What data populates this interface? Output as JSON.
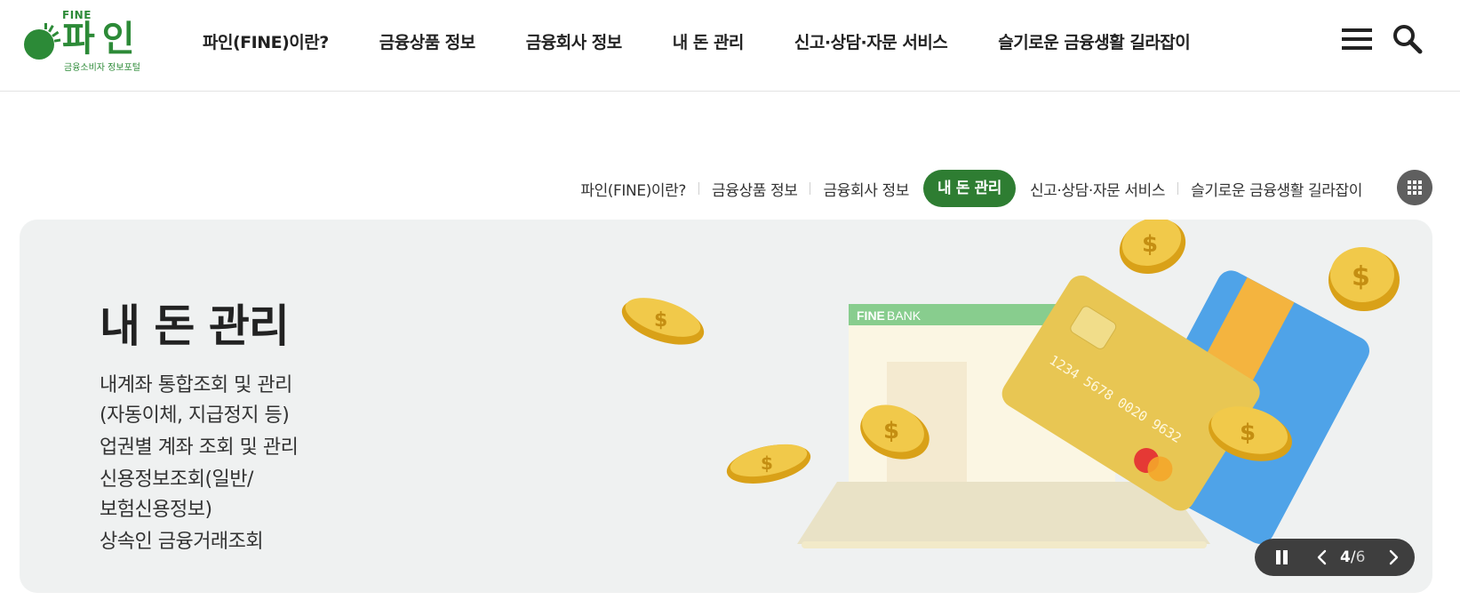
{
  "logo": {
    "brand_en": "FINE",
    "brand_ko": "파인",
    "subtitle": "금융소비자 정보포털",
    "color": "#2c8a37"
  },
  "gnb": {
    "items": [
      {
        "label": "파인(FINE)이란?"
      },
      {
        "label": "금융상품 정보"
      },
      {
        "label": "금융회사 정보"
      },
      {
        "label": "내 돈 관리"
      },
      {
        "label": "신고·상담·자문 서비스"
      },
      {
        "label": "슬기로운 금융생활 길라잡이"
      }
    ],
    "icons": [
      "hamburger-icon",
      "search-icon"
    ]
  },
  "subnav": {
    "items": [
      {
        "label": "파인(FINE)이란?",
        "active": false
      },
      {
        "label": "금융상품 정보",
        "active": false
      },
      {
        "label": "금융회사 정보",
        "active": false
      },
      {
        "label": "내 돈 관리",
        "active": true
      },
      {
        "label": "신고·상담·자문 서비스",
        "active": false
      },
      {
        "label": "슬기로운 금융생활 길라잡이",
        "active": false
      }
    ],
    "active_color": "#2e7d32",
    "grid_icon": "grid-menu-icon"
  },
  "hero": {
    "title": "내 돈 관리",
    "items": [
      "내계좌 통합조회 및 관리\n(자동이체, 지급정지 등)",
      "업권별 계좌 조회 및 관리",
      "신용정보조회(일반/\n보험신용정보)",
      "상속인 금융거래조회"
    ],
    "background": "#eff1f1",
    "illustration": {
      "bank_label_bold": "FINE",
      "bank_label": "BANK",
      "card_number": "1234 5678 0020 9632"
    }
  },
  "pager": {
    "current": "4",
    "separator": "/",
    "total": "6",
    "icons": [
      "pause-icon",
      "chevron-left-icon",
      "chevron-right-icon"
    ]
  }
}
